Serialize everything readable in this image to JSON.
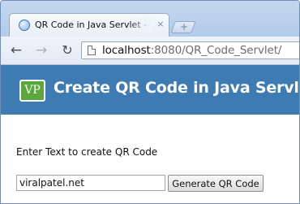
{
  "browser": {
    "tab": {
      "title": "QR Code in Java Servlet - viralpatel.net",
      "close_glyph": "×",
      "favicon_icon": "globe-icon"
    },
    "new_tab_glyph": "+",
    "toolbar": {
      "back_glyph": "←",
      "forward_glyph": "→",
      "reload_glyph": "↻"
    },
    "address": {
      "host": "localhost",
      "rest": ":8080/QR_Code_Servlet/",
      "page_icon": "page-icon"
    }
  },
  "page": {
    "header": {
      "logo_text": "VP",
      "title": "Create QR Code in Java Servlet",
      "background_color": "#3e7bb3",
      "logo_color": "#5aa83c"
    },
    "form": {
      "label": "Enter Text to create QR Code",
      "input_value": "viralpatel.net",
      "button_label": "Generate QR Code"
    }
  }
}
